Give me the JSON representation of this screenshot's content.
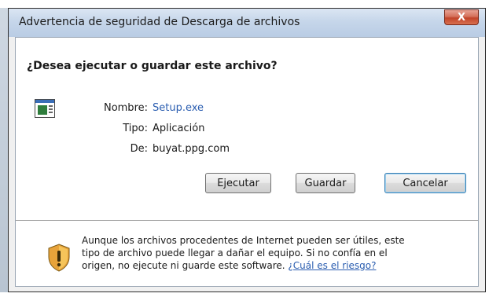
{
  "window": {
    "title": "Advertencia de seguridad de Descarga de archivos",
    "close_label": "X"
  },
  "dialog": {
    "heading": "¿Desea ejecutar o guardar este archivo?",
    "file": {
      "name_label": "Nombre:",
      "name_value": "Setup.exe",
      "type_label": "Tipo:",
      "type_value": "Aplicación",
      "from_label": "De:",
      "from_value": "buyat.ppg.com"
    },
    "buttons": {
      "run": "Ejecutar",
      "save": "Guardar",
      "cancel": "Cancelar"
    },
    "warning": {
      "text": "Aunque los archivos procedentes de Internet pueden ser útiles, este tipo de archivo puede llegar a dañar el equipo. Si no confía en el origen, no ejecute ni guarde este software.",
      "link": "¿Cuál es el riesgo?"
    }
  },
  "colors": {
    "link": "#2a5db0",
    "close_button": "#c2442a",
    "shield": "#e8a33a"
  },
  "icons": {
    "file": "application-window-icon",
    "warning": "security-shield-warning-icon",
    "close": "close-x-icon"
  }
}
